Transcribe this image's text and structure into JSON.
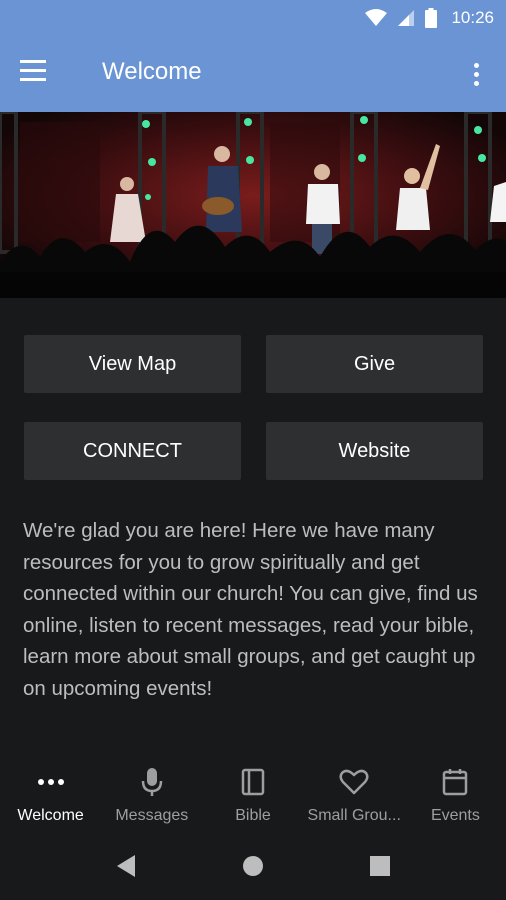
{
  "status": {
    "time": "10:26"
  },
  "app_bar": {
    "title": "Welcome"
  },
  "buttons": {
    "view_map": "View Map",
    "give": "Give",
    "connect": "CONNECT",
    "website": "Website"
  },
  "welcome_text": "We're glad you are here!  Here we have many resources for you to grow spiritually and get connected within our church! You can give, find us online, listen to recent messages, read your bible, learn more about small groups, and get caught up on upcoming events!",
  "bottom_nav": {
    "items": [
      {
        "label": "Welcome",
        "icon": "more-dots-icon",
        "active": true
      },
      {
        "label": "Messages",
        "icon": "microphone-icon",
        "active": false
      },
      {
        "label": "Bible",
        "icon": "book-icon",
        "active": false
      },
      {
        "label": "Small Grou...",
        "icon": "heart-icon",
        "active": false
      },
      {
        "label": "Events",
        "icon": "calendar-icon",
        "active": false
      }
    ]
  },
  "colors": {
    "app_bar": "#6a94d4",
    "background": "#18191b",
    "button": "#2e2f31"
  }
}
